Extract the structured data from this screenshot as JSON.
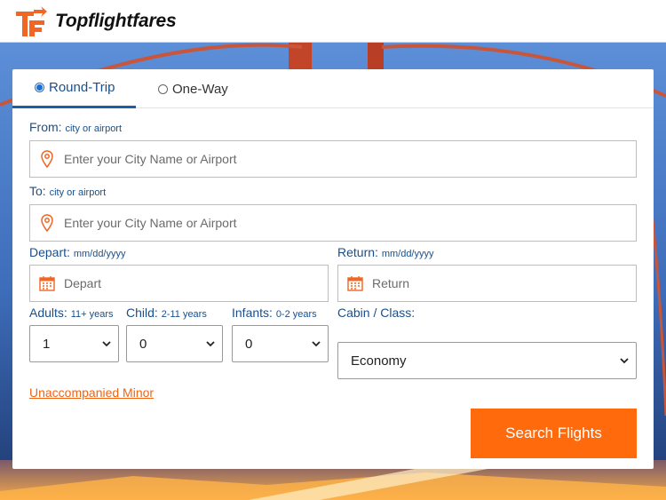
{
  "brand": {
    "name": "Topflightfares",
    "accent": "#f26522"
  },
  "tabs": [
    {
      "label": "Round-Trip",
      "selected": true
    },
    {
      "label": "One-Way",
      "selected": false
    }
  ],
  "from": {
    "label": "From:",
    "hint": "city or airport",
    "placeholder": "Enter your City Name or Airport",
    "icon": "location-pin-icon"
  },
  "to": {
    "label": "To:",
    "hint": "city or airport",
    "placeholder": "Enter your City Name or Airport",
    "icon": "location-pin-icon"
  },
  "depart": {
    "label": "Depart:",
    "hint": "mm/dd/yyyy",
    "placeholder": "Depart",
    "icon": "calendar-icon"
  },
  "return": {
    "label": "Return:",
    "hint": "mm/dd/yyyy",
    "placeholder": "Return",
    "icon": "calendar-icon"
  },
  "adults": {
    "label": "Adults:",
    "hint": "11+ years",
    "value": "1"
  },
  "child": {
    "label": "Child:",
    "hint": "2-11 years",
    "value": "0"
  },
  "infants": {
    "label": "Infants:",
    "hint": "0-2 years",
    "value": "0"
  },
  "cabin": {
    "label": "Cabin / Class:",
    "value": "Economy"
  },
  "minor_link": "Unaccompanied Minor",
  "search_button": "Search Flights",
  "colors": {
    "primary_blue": "#1a4f8a",
    "cta_orange": "#ff6a0d",
    "link_orange": "#f06414"
  }
}
